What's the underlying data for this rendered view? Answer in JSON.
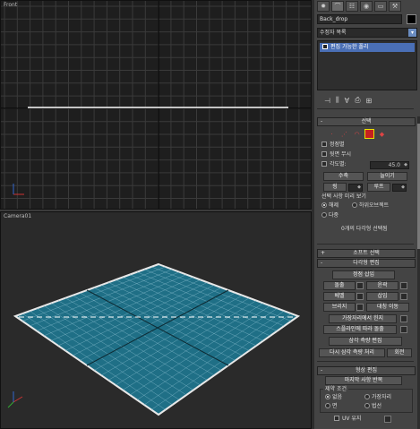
{
  "viewports": {
    "top_label": "Front",
    "bottom_label": "Camera01"
  },
  "panel": {
    "tabs": [
      {
        "icon": "create-icon",
        "glyph": "✹"
      },
      {
        "icon": "modify-icon",
        "glyph": "⌒"
      },
      {
        "icon": "hierarchy-icon",
        "glyph": "☷"
      },
      {
        "icon": "motion-icon",
        "glyph": "◉"
      },
      {
        "icon": "display-icon",
        "glyph": "▭"
      },
      {
        "icon": "utilities-icon",
        "glyph": "⚒"
      }
    ],
    "object_name": "Back_drop",
    "object_color": "#000000",
    "modifier_list": "수정자 목록",
    "stack_item": "편집 가능한 폴리",
    "stack_tools": [
      "⊣",
      "⫼",
      "∀",
      "⎙",
      "⊞"
    ],
    "selection": {
      "title": "선택",
      "sign": "-",
      "levels": [
        "·",
        "⋰",
        "◠",
        "■",
        "◆"
      ],
      "selected_level": 3,
      "vertex_label": "정점별",
      "backface_label": "뒷면 무시",
      "angle_label": "각도별:",
      "angle_value": "45.0",
      "shrink_label": "수축",
      "grow_label": "늘이기",
      "ring_label": "링",
      "loop_label": "루프",
      "preview_title": "선택 사항 미리 보기",
      "preview_options": [
        "해제",
        "하위오브젝트",
        "다중"
      ],
      "status": "0개의 다각형 선택됨"
    },
    "soft_selection": {
      "sign": "+",
      "title": "소프트 선택"
    },
    "edit_polygons": {
      "sign": "-",
      "title": "다각형 편집",
      "insert_vertex": "정점 삽입",
      "row1": [
        "돌출",
        "윤곽"
      ],
      "row2": [
        "베벨",
        "삽입"
      ],
      "row3": [
        "브리지",
        "대칭 이동"
      ],
      "hinge": "가장자리에서 힌지",
      "extrude_spline": "스플라인에 따라 돌출",
      "edit_tri": "삼각 측량 편집",
      "retri": "다시 삼각 측량 처리",
      "turn": "회전"
    },
    "edit_geometry": {
      "sign": "-",
      "title": "형상 편집",
      "repeat": "마지막 사항 반복",
      "constraints_title": "제약 조건",
      "constraints": [
        "없음",
        "가장자리",
        "면",
        "법선"
      ],
      "preserve_uv": "UV 유지"
    }
  },
  "colors": {
    "plane": "#1f6f86",
    "grid": "#3a3a3a",
    "accent": "#4a6fb5"
  }
}
